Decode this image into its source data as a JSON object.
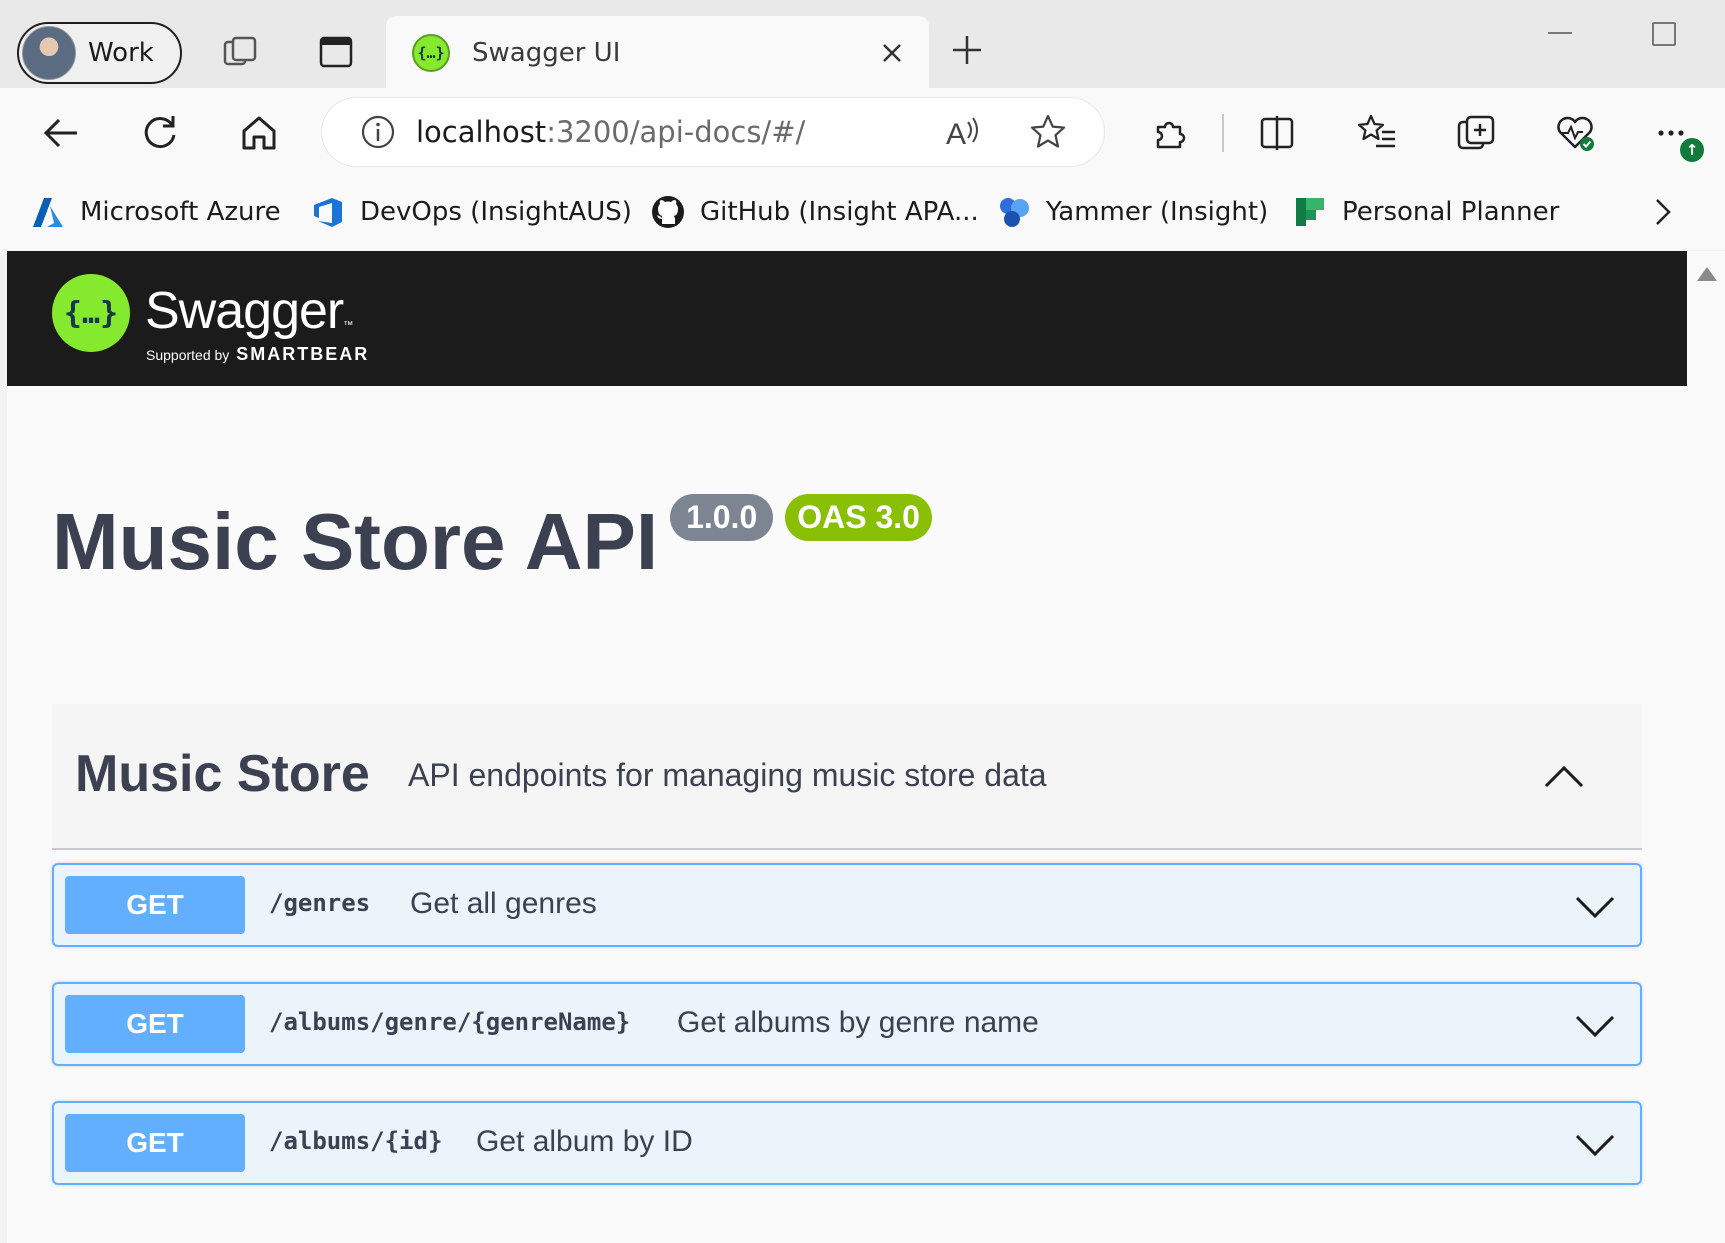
{
  "browser": {
    "profile": {
      "label": "Work"
    },
    "tab": {
      "title": "Swagger UI",
      "favicon": "swagger-icon"
    },
    "address": {
      "host": "localhost",
      "path": ":3200/api-docs/#/"
    },
    "favorites": [
      {
        "label": "Microsoft Azure",
        "icon": "azure-icon"
      },
      {
        "label": "DevOps (InsightAUS)",
        "icon": "devops-icon"
      },
      {
        "label": "GitHub (Insight APA...",
        "icon": "github-icon"
      },
      {
        "label": "Yammer (Insight)",
        "icon": "yammer-icon"
      },
      {
        "label": "Personal Planner",
        "icon": "planner-icon"
      }
    ]
  },
  "swagger": {
    "logo_text": "Swagger",
    "supported_by": "Supported by",
    "brand": "SMARTBEAR",
    "title": "Music Store API",
    "version": "1.0.0",
    "oas": "OAS 3.0",
    "tag": {
      "name": "Music Store",
      "description": "API endpoints for managing music store data"
    },
    "operations": [
      {
        "method": "GET",
        "path": "/genres",
        "summary": "Get all genres"
      },
      {
        "method": "GET",
        "path": "/albums/genre/{genreName}",
        "summary": "Get albums by genre name"
      },
      {
        "method": "GET",
        "path": "/albums/{id}",
        "summary": "Get album by ID"
      }
    ]
  },
  "colors": {
    "get_method": "#61affe",
    "get_bg": "#ebf3fb",
    "swagger_green": "#85ea2d",
    "header_bg": "#1b1b1b",
    "oas_badge": "#89bf04",
    "version_badge": "#7d8492"
  }
}
